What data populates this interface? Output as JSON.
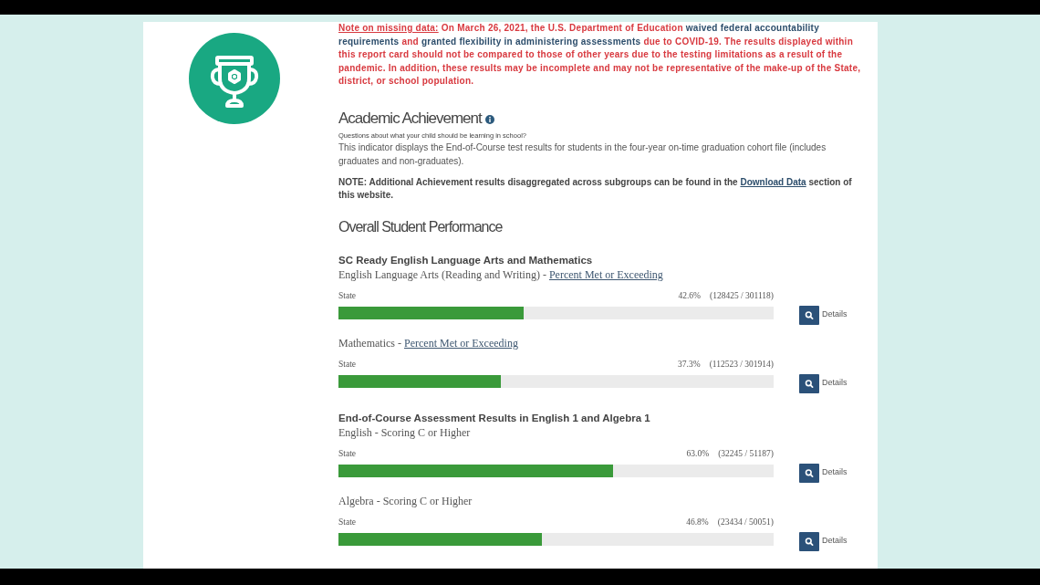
{
  "notice": {
    "segments": [
      {
        "kind": "label",
        "text": "Note on missing data:"
      },
      {
        "kind": "warning",
        "text": " On March 26, 2021, the U.S. Department of Education "
      },
      {
        "kind": "emphasis",
        "text": "waived federal accountability requirements"
      },
      {
        "kind": "warning",
        "text": " and "
      },
      {
        "kind": "emphasis",
        "text": "granted flexibility in administering assessments"
      },
      {
        "kind": "warning",
        "text": " due to COVID-19. The results displayed within this report card should not be compared to those of other years due to the testing limitations as a result of the pandemic. In addition, these results may be incomplete and may not be representative of the make-up of the State, district, or school population."
      }
    ]
  },
  "indicator": {
    "title": "Academic Achievement",
    "question": "Questions about what your child should be learning in school?",
    "description": "This indicator displays the End-of-Course test results for students in the four-year on-time graduation cohort file (includes graduates and non-graduates).",
    "note": {
      "before": "NOTE: Additional Achievement results disaggregated across subgroups can be found in the",
      "link": "Download Data",
      "after": "section of this website."
    }
  },
  "performance": {
    "title": "Overall Student Performance",
    "groups": [
      {
        "title": "SC Ready English Language Arts and Mathematics",
        "measures": [
          {
            "subject": "English Language Arts (Reading and Writing) -",
            "link": "Percent Met or Exceeding",
            "scope": "State",
            "percent": "42.6%",
            "counts": "(128425 / 301118)",
            "level": 0.426,
            "action": "Details"
          },
          {
            "subject": "Mathematics -",
            "link": "Percent Met or Exceeding",
            "scope": "State",
            "percent": "37.3%",
            "counts": "(112523 / 301914)",
            "level": 0.373,
            "action": "Details"
          }
        ]
      },
      {
        "title": "End-of-Course Assessment Results in English 1 and Algebra 1",
        "measures": [
          {
            "subject": "English - Scoring C or Higher",
            "scope": "State",
            "percent": "63.0%",
            "counts": "(32245 / 51187)",
            "level": 0.63,
            "action": "Details"
          },
          {
            "subject": "Algebra - Scoring C or Higher",
            "scope": "State",
            "percent": "46.8%",
            "counts": "(23434 / 50051)",
            "level": 0.468,
            "action": "Details"
          }
        ]
      }
    ]
  }
}
